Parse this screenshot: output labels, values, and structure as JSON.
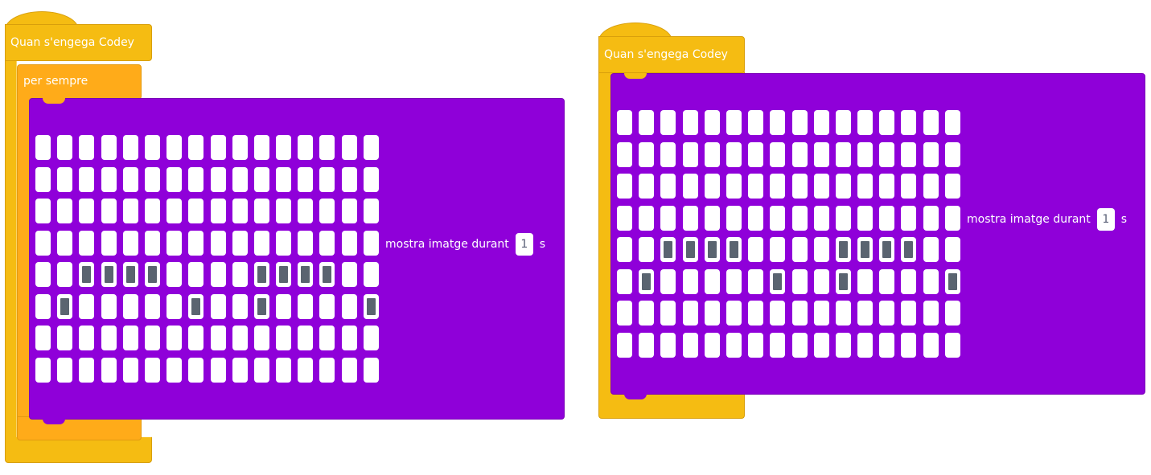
{
  "scripts": [
    {
      "hat_label": "Quan s'engega Codey",
      "loop_label": "per sempre",
      "display": {
        "label": "mostra imatge durant",
        "duration_value": "1",
        "unit": "s",
        "rows": [
          "0000000000000000",
          "0000000000000000",
          "0000000000000000",
          "0000000000000000",
          "0011110000111100",
          "0100000100100001",
          "0000000000000000",
          "0000000000000000"
        ]
      }
    },
    {
      "hat_label": "Quan s'engega Codey",
      "display": {
        "label": "mostra imatge durant",
        "duration_value": "1",
        "unit": "s",
        "rows": [
          "0000000000000000",
          "0000000000000000",
          "0000000000000000",
          "0000000000000000",
          "0011110000111100",
          "0100000100100001",
          "0000000000000000",
          "0000000000000000"
        ]
      }
    }
  ],
  "colors": {
    "hat_block": "#f5bc12",
    "loop_block": "#ffab19",
    "display_block": "#8f00d9",
    "pixel_off": "#ffffff",
    "pixel_on": "#5a6470"
  }
}
